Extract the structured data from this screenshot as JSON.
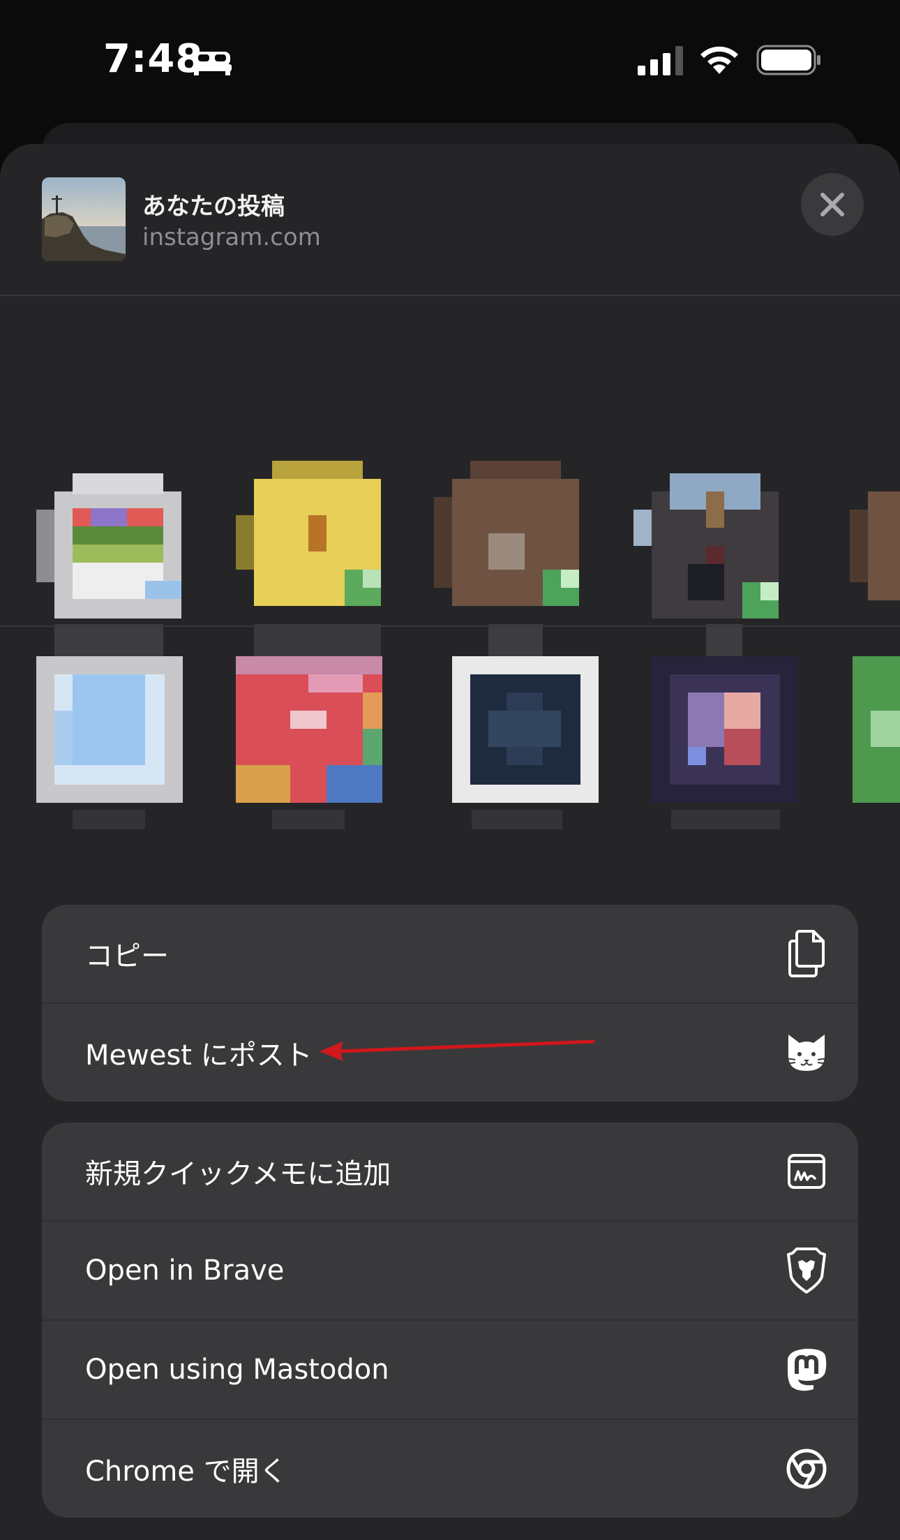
{
  "status_bar": {
    "time": "7:48",
    "icons": [
      "bed-icon",
      "cellular-signal-icon",
      "wifi-icon",
      "battery-icon"
    ]
  },
  "share_sheet": {
    "title": "あなたの投稿",
    "subtitle": "instagram.com",
    "close_icon": "close-icon"
  },
  "action_groups": [
    {
      "items": [
        {
          "label": "コピー",
          "icon": "copy-icon"
        },
        {
          "label": "Mewest にポスト",
          "icon": "cat-icon"
        }
      ]
    },
    {
      "items": [
        {
          "label": "新規クイックメモに追加",
          "icon": "quick-note-icon"
        },
        {
          "label": "Open in Brave",
          "icon": "brave-icon"
        },
        {
          "label": "Open using Mastodon",
          "icon": "mastodon-icon"
        },
        {
          "label": "Chrome で開く",
          "icon": "chrome-icon"
        }
      ]
    }
  ],
  "annotation": {
    "color": "#d0171b"
  }
}
